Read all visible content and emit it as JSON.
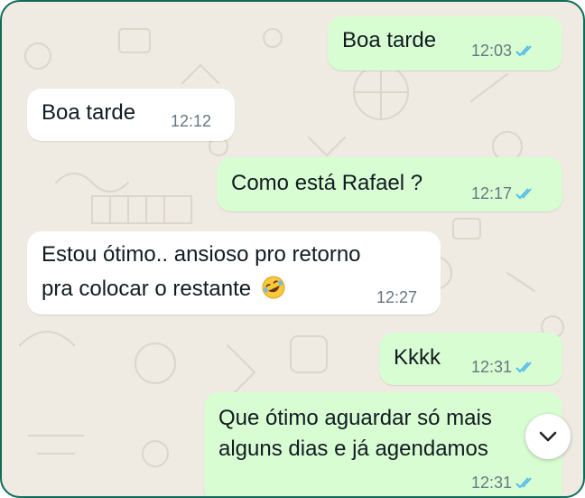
{
  "colors": {
    "chat_background": "#efeae2",
    "outgoing_bubble": "#d9fdd3",
    "incoming_bubble": "#ffffff",
    "read_ticks": "#53bdeb",
    "frame_border": "#0e6b58"
  },
  "messages": [
    {
      "direction": "outgoing",
      "text": "Boa tarde",
      "time": "12:03",
      "status": "read"
    },
    {
      "direction": "incoming",
      "text": "Boa tarde",
      "time": "12:12"
    },
    {
      "direction": "outgoing",
      "text": "Como está Rafael ?",
      "time": "12:17",
      "status": "read"
    },
    {
      "direction": "incoming",
      "lines": [
        "Estou ótimo.. ansioso pro retorno",
        "pra colocar o restante"
      ],
      "emoji": "rolling-on-floor-laughing-emoji",
      "time": "12:27"
    },
    {
      "direction": "outgoing",
      "text": "Kkkk",
      "time": "12:31",
      "status": "read"
    },
    {
      "direction": "outgoing",
      "lines": [
        "Que ótimo aguardar só mais",
        "alguns dias e já agendamos"
      ],
      "time": "12:31",
      "status": "read"
    }
  ],
  "scroll_button": {
    "icon": "chevron-down-icon"
  }
}
